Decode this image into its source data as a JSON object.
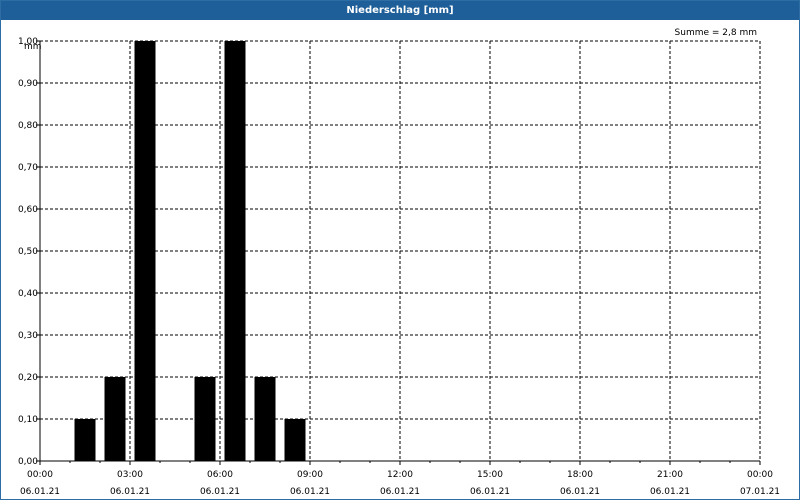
{
  "chart_data": {
    "type": "bar",
    "title": "Niederschlag [mm]",
    "ylabel": "mm",
    "summary": "Summe = 2,8 mm",
    "ylim": [
      0,
      1.0
    ],
    "yticks": [
      "0,00",
      "0,10",
      "0,20",
      "0,30",
      "0,40",
      "0,50",
      "0,60",
      "0,70",
      "0,80",
      "0,90",
      "1,00"
    ],
    "xlim_hours": [
      0,
      24
    ],
    "xticks": [
      {
        "time": "00:00",
        "date": "06.01.21"
      },
      {
        "time": "03:00",
        "date": "06.01.21"
      },
      {
        "time": "06:00",
        "date": "06.01.21"
      },
      {
        "time": "09:00",
        "date": "06.01.21"
      },
      {
        "time": "12:00",
        "date": "06.01.21"
      },
      {
        "time": "15:00",
        "date": "06.01.21"
      },
      {
        "time": "18:00",
        "date": "06.01.21"
      },
      {
        "time": "21:00",
        "date": "06.01.21"
      },
      {
        "time": "00:00",
        "date": "07.01.21"
      }
    ],
    "bars": [
      {
        "x": "01:30",
        "value": 0.1
      },
      {
        "x": "02:30",
        "value": 0.2
      },
      {
        "x": "03:30",
        "value": 1.0
      },
      {
        "x": "05:30",
        "value": 0.2
      },
      {
        "x": "06:30",
        "value": 1.0
      },
      {
        "x": "07:30",
        "value": 0.2
      },
      {
        "x": "08:30",
        "value": 0.1
      }
    ],
    "grid": true,
    "colors": {
      "bar": "#000000",
      "grid": "#000000",
      "title_bg": "#1f5f99",
      "title_text": "#ffffff"
    }
  }
}
